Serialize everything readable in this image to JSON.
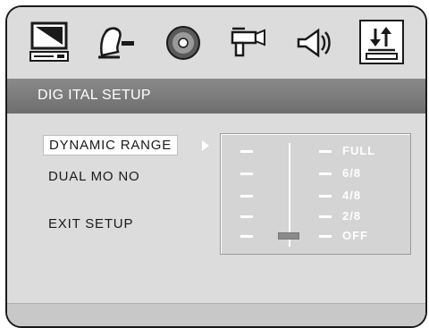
{
  "icon_bar": {
    "icons": [
      {
        "name": "computer-monitor-icon",
        "selected": false
      },
      {
        "name": "person-face-icon",
        "selected": false
      },
      {
        "name": "disc-icon",
        "selected": false
      },
      {
        "name": "video-camera-icon",
        "selected": false
      },
      {
        "name": "speaker-icon",
        "selected": false
      },
      {
        "name": "up-down-arrows-icon",
        "selected": true
      }
    ]
  },
  "title_bar": {
    "label": "DIG ITAL SETUP"
  },
  "menu": {
    "dynamic_range": "DYNAMIC  RANGE",
    "dual_mono": "DUAL MO NO",
    "exit_setup": "EXIT SETUP"
  },
  "range_panel": {
    "levels": [
      "FULL",
      "6/8",
      "4/8",
      "2/8",
      "OFF"
    ],
    "selected_level": "OFF"
  },
  "colors": {
    "title_bar": "#7c7c7c",
    "background": "#dcdcdc",
    "text_light": "#ffffff",
    "text_dark": "#1a1a1a"
  }
}
